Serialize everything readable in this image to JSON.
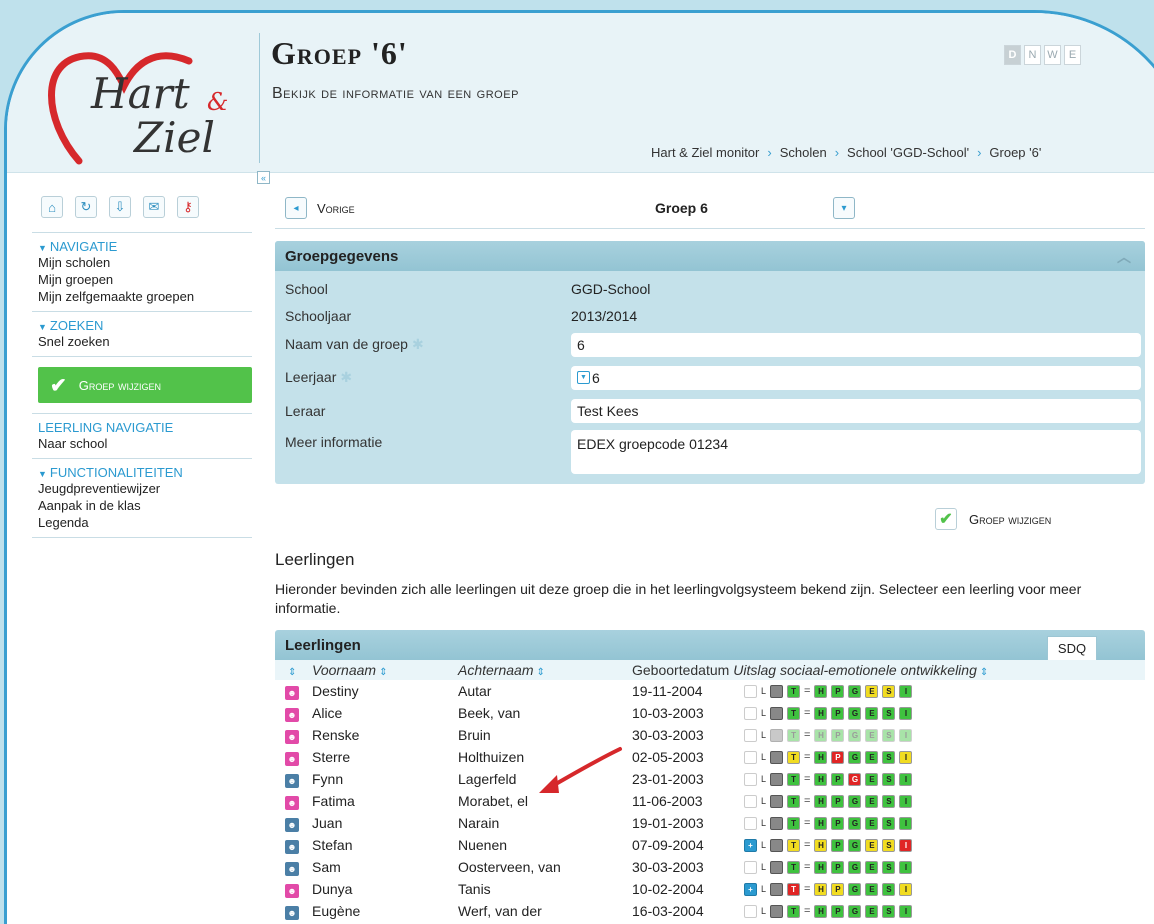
{
  "page": {
    "title": "Groep '6'",
    "subtitle": "Bekijk de informatie van een groep",
    "languages": [
      "D",
      "N",
      "W",
      "E"
    ],
    "breadcrumb": [
      "Hart & Ziel monitor",
      "Scholen",
      "School 'GGD-School'",
      "Groep '6'"
    ]
  },
  "logo": {
    "line1": "Hart",
    "amp": "&",
    "line2": "Ziel"
  },
  "sidebar": {
    "sections": [
      {
        "head": "NAVIGATIE",
        "items": [
          "Mijn scholen",
          "Mijn groepen",
          "Mijn zelfgemaakte groepen"
        ]
      },
      {
        "head": "ZOEKEN",
        "items": [
          "Snel zoeken"
        ]
      }
    ],
    "edit_button": "Groep wijzigen",
    "leerling_head": "LEERLING NAVIGATIE",
    "leerling_items": [
      "Naar school"
    ],
    "func_head": "FUNCTIONALITEITEN",
    "func_items": [
      "Jeugdpreventiewijzer",
      "Aanpak in de klas",
      "Legenda"
    ]
  },
  "topnav": {
    "prev_label": "Vorige",
    "current": "Groep 6"
  },
  "panel": {
    "title": "Groepgegevens",
    "school_label": "School",
    "school_value": "GGD-School",
    "year_label": "Schooljaar",
    "year_value": "2013/2014",
    "name_label": "Naam van de groep",
    "name_value": "6",
    "grade_label": "Leerjaar",
    "grade_value": "6",
    "teacher_label": "Leraar",
    "teacher_value": "Test Kees",
    "info_label": "Meer informatie",
    "info_value": "EDEX groepcode 01234"
  },
  "action": {
    "label": "Groep wijzigen"
  },
  "students_section": {
    "title": "Leerlingen",
    "description": "Hieronder bevinden zich alle leerlingen uit deze groep die in het leerlingvolgsysteem bekend zijn. Selecteer een leerling voor meer informatie."
  },
  "table": {
    "title": "Leerlingen",
    "tab": "SDQ",
    "columns": {
      "first": "Voornaam",
      "last": "Achternaam",
      "date": "Geboortedatum",
      "result": "Uitslag sociaal-emotionele ontwikkeling"
    },
    "rows": [
      {
        "gender": "f",
        "first": "Destiny",
        "last": "Autar",
        "date": "19-11-2004",
        "plus": false,
        "s": [
          "grey",
          "g",
          "g",
          "g",
          "g",
          "y",
          "g"
        ],
        "fade": false
      },
      {
        "gender": "f",
        "first": "Alice",
        "last": "Beek, van",
        "date": "10-03-2003",
        "plus": false,
        "s": [
          "grey",
          "g",
          "g",
          "g",
          "g",
          "g",
          "g"
        ],
        "fade": false
      },
      {
        "gender": "f",
        "first": "Renske",
        "last": "Bruin",
        "date": "30-03-2003",
        "plus": false,
        "s": [
          "grey",
          "g",
          "g",
          "g",
          "g",
          "g",
          "g"
        ],
        "fade": true
      },
      {
        "gender": "f",
        "first": "Sterre",
        "last": "Holthuizen",
        "date": "02-05-2003",
        "plus": false,
        "s": [
          "grey",
          "y",
          "g",
          "r",
          "g",
          "g",
          "y"
        ],
        "fade": false
      },
      {
        "gender": "m",
        "first": "Fynn",
        "last": "Lagerfeld",
        "date": "23-01-2003",
        "plus": false,
        "s": [
          "grey",
          "g",
          "g",
          "g",
          "r",
          "g",
          "g"
        ],
        "fade": false
      },
      {
        "gender": "f",
        "first": "Fatima",
        "last": "Morabet, el",
        "date": "11-06-2003",
        "plus": false,
        "s": [
          "grey",
          "g",
          "g",
          "g",
          "g",
          "g",
          "g"
        ],
        "fade": false
      },
      {
        "gender": "m",
        "first": "Juan",
        "last": "Narain",
        "date": "19-01-2003",
        "plus": false,
        "s": [
          "grey",
          "g",
          "g",
          "g",
          "g",
          "g",
          "g"
        ],
        "fade": false
      },
      {
        "gender": "m",
        "first": "Stefan",
        "last": "Nuenen",
        "date": "07-09-2004",
        "plus": true,
        "s": [
          "grey",
          "y",
          "y",
          "g",
          "g",
          "y",
          "r"
        ],
        "fade": false
      },
      {
        "gender": "m",
        "first": "Sam",
        "last": "Oosterveen, van",
        "date": "30-03-2003",
        "plus": false,
        "s": [
          "grey",
          "g",
          "g",
          "g",
          "g",
          "g",
          "g"
        ],
        "fade": false
      },
      {
        "gender": "f",
        "first": "Dunya",
        "last": "Tanis",
        "date": "10-02-2004",
        "plus": true,
        "s": [
          "grey",
          "r",
          "y",
          "y",
          "g",
          "g",
          "y"
        ],
        "fade": false
      },
      {
        "gender": "m",
        "first": "Eugène",
        "last": "Werf, van der",
        "date": "16-03-2004",
        "plus": false,
        "s": [
          "grey",
          "g",
          "g",
          "g",
          "g",
          "g",
          "g"
        ],
        "fade": false
      }
    ],
    "score_letters": [
      "L",
      "",
      "T",
      "H",
      "P",
      "G",
      "E",
      "S",
      "I"
    ]
  }
}
